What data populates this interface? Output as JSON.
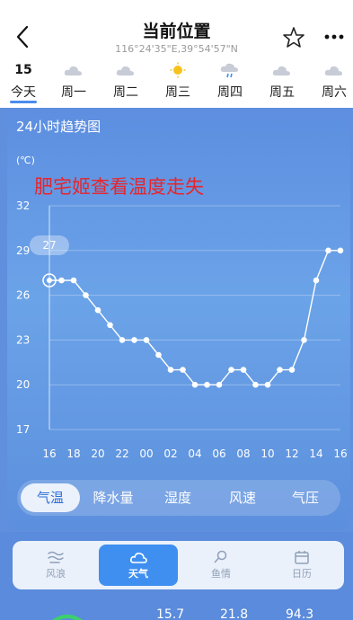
{
  "header": {
    "title": "当前位置",
    "coords": "116°24'35\"E,39°54'57\"N"
  },
  "days": [
    {
      "top": "15",
      "label": "今天",
      "icon": "today",
      "active": true
    },
    {
      "label": "周一",
      "icon": "cloudy-icon"
    },
    {
      "label": "周二",
      "icon": "cloudy-icon"
    },
    {
      "label": "周三",
      "icon": "sun-icon"
    },
    {
      "label": "周四",
      "icon": "rain-icon"
    },
    {
      "label": "周五",
      "icon": "cloudy-icon"
    },
    {
      "label": "周六",
      "icon": "cloudy-icon"
    }
  ],
  "panel": {
    "title": "24小时趋势图",
    "unit": "(℃)",
    "watermark": "肥宅姬查看温度走失"
  },
  "chart_data": {
    "type": "line",
    "yticks": [
      17,
      20,
      23,
      26,
      29,
      32
    ],
    "ytick_labels": [
      "17",
      "20",
      "23",
      "26",
      "29",
      "32"
    ],
    "xtick_labels": [
      "16",
      "18",
      "20",
      "22",
      "00",
      "02",
      "04",
      "06",
      "08",
      "10",
      "12",
      "14",
      "16"
    ],
    "ylim": [
      17,
      32
    ],
    "series": [
      {
        "values": [
          27,
          27,
          27,
          26,
          25,
          24,
          23,
          23,
          23,
          22,
          21,
          21,
          20,
          20,
          20,
          21,
          21,
          20,
          20,
          21,
          21,
          23,
          27,
          29,
          29
        ]
      }
    ],
    "current_value": "27",
    "grid": true
  },
  "tabs": [
    "气温",
    "降水量",
    "湿度",
    "风速",
    "气压"
  ],
  "nav": [
    {
      "label": "风浪",
      "icon": "wave-icon"
    },
    {
      "label": "天气",
      "icon": "cloud-icon",
      "active": true
    },
    {
      "label": "鱼情",
      "icon": "fish-icon"
    },
    {
      "label": "日历",
      "icon": "calendar-icon"
    }
  ],
  "peek": [
    "15.7",
    "21.8",
    "94.3"
  ],
  "colors": {
    "accent": "#3f8ff0",
    "panel": "#6a9ee6",
    "watermark": "#e8252b"
  }
}
